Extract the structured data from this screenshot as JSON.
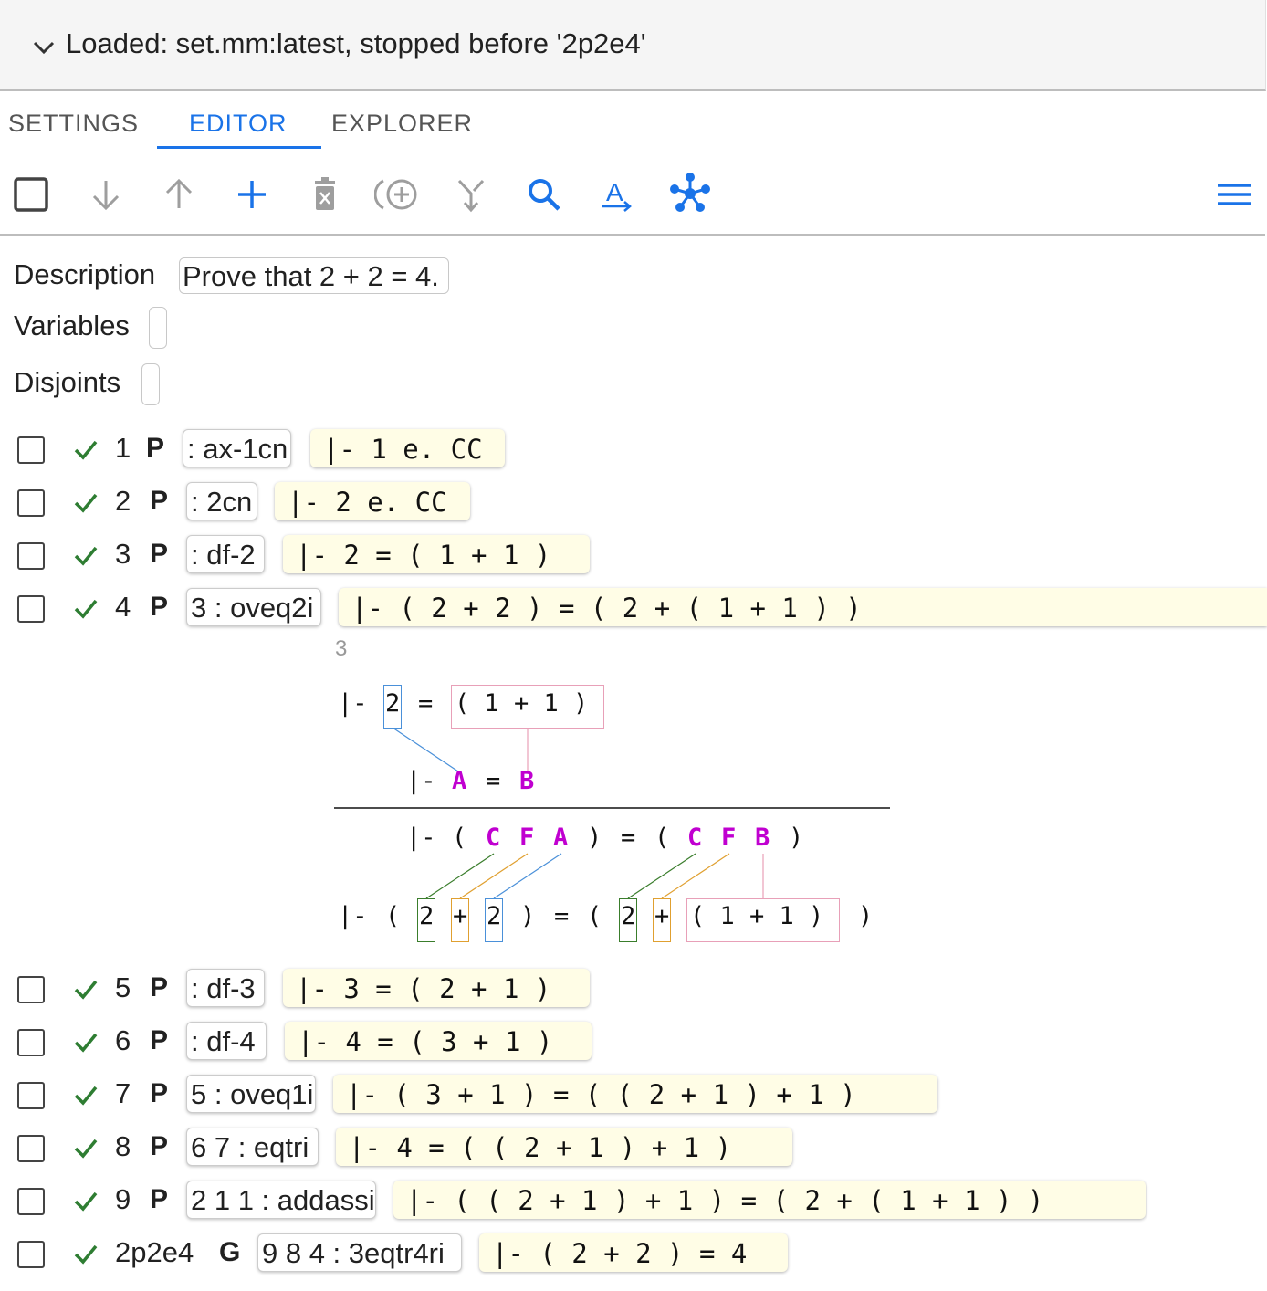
{
  "header": {
    "title": "Loaded: set.mm:latest, stopped before '2p2e4'"
  },
  "tabs": [
    {
      "label": "SETTINGS"
    },
    {
      "label": "EDITOR",
      "active": true
    },
    {
      "label": "EXPLORER"
    }
  ],
  "toolbar": {
    "icons": [
      "select-all-checkbox",
      "move-down-icon",
      "move-up-icon",
      "add-icon",
      "delete-icon",
      "add-circle-icon",
      "merge-icon",
      "search-icon",
      "substitute-icon",
      "unify-icon",
      "menu-icon"
    ],
    "accent": "#1a73e8",
    "disabled_color": "#9e9e9e"
  },
  "fields": {
    "description_label": "Description",
    "description_value": "Prove that 2 + 2 = 4.",
    "variables_label": "Variables",
    "variables_value": "",
    "disjoints_label": "Disjoints",
    "disjoints_value": ""
  },
  "steps": [
    {
      "label": "1",
      "type": "P",
      "just": ": ax-1cn",
      "expr": "|- 1 e. CC"
    },
    {
      "label": "2",
      "type": "P",
      "just": ": 2cn",
      "expr": "|- 2 e. CC"
    },
    {
      "label": "3",
      "type": "P",
      "just": ": df-2",
      "expr": "|- 2 = ( 1 + 1 )"
    },
    {
      "label": "4",
      "type": "P",
      "just": "3 : oveq2i",
      "expr": "|- ( 2 + 2 ) = ( 2 + ( 1 + 1 ) )"
    },
    {
      "label": "5",
      "type": "P",
      "just": ": df-3",
      "expr": "|- 3 = ( 2 + 1 )"
    },
    {
      "label": "6",
      "type": "P",
      "just": ": df-4",
      "expr": "|- 4 = ( 3 + 1 )"
    },
    {
      "label": "7",
      "type": "P",
      "just": "5 : oveq1i",
      "expr": "|- ( 3 + 1 ) = ( ( 2 + 1 ) + 1 )"
    },
    {
      "label": "8",
      "type": "P",
      "just": "6 7 : eqtri",
      "expr": "|- 4 = ( ( 2 + 1 ) + 1 )"
    },
    {
      "label": "9",
      "type": "P",
      "just": "2 1 1 : addassi",
      "expr": "|- ( ( 2 + 1 ) + 1 ) = ( 2 + ( 1 + 1 ) )"
    },
    {
      "label": "2p2e4",
      "type": "G",
      "just": "9 8 4 : 3eqtr4ri",
      "expr": "|- ( 2 + 2 ) = 4"
    }
  ],
  "detail": {
    "hyp_label": "3",
    "hyp_tokens": [
      "|-",
      "2",
      "=",
      "( 1 + 1 )"
    ],
    "rule_hyp": [
      "|-",
      "A",
      "=",
      "B"
    ],
    "rule_concl": [
      "|-",
      "(",
      "C",
      "F",
      "A",
      ")",
      "=",
      "(",
      "C",
      "F",
      "B",
      ")"
    ],
    "result": [
      "|-",
      "(",
      "2",
      "+",
      "2",
      ")",
      "=",
      "(",
      "2",
      "+",
      "( 1 + 1 )",
      ")"
    ],
    "colors": {
      "blue": "#4a90d9",
      "pink": "#e8a0b8",
      "green": "#3a7d2c",
      "orange": "#e0a030",
      "var": "#c000d0"
    }
  },
  "status_color": "#2e7d32"
}
